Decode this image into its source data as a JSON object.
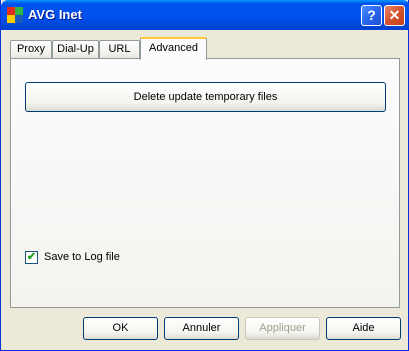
{
  "window": {
    "title": "AVG Inet",
    "help_glyph": "?",
    "close_glyph": "✕"
  },
  "tabs": [
    {
      "label": "Proxy"
    },
    {
      "label": "Dial-Up"
    },
    {
      "label": "URL"
    },
    {
      "label": "Advanced",
      "active": true
    }
  ],
  "panel": {
    "delete_button_label": "Delete update temporary files",
    "save_log_label": "Save to Log file",
    "save_log_checked": true,
    "check_glyph": "✔"
  },
  "footer": {
    "ok_label": "OK",
    "cancel_label": "Annuler",
    "apply_label": "Appliquer",
    "help_label": "Aide"
  },
  "colors": {
    "titlebar": "#0054e3",
    "close_button": "#d5532c",
    "active_tab_accent": "#ffc83c"
  },
  "icons": {
    "app": "avg-logo-icon",
    "help": "question-icon",
    "close": "close-icon",
    "check": "checkmark-icon"
  }
}
